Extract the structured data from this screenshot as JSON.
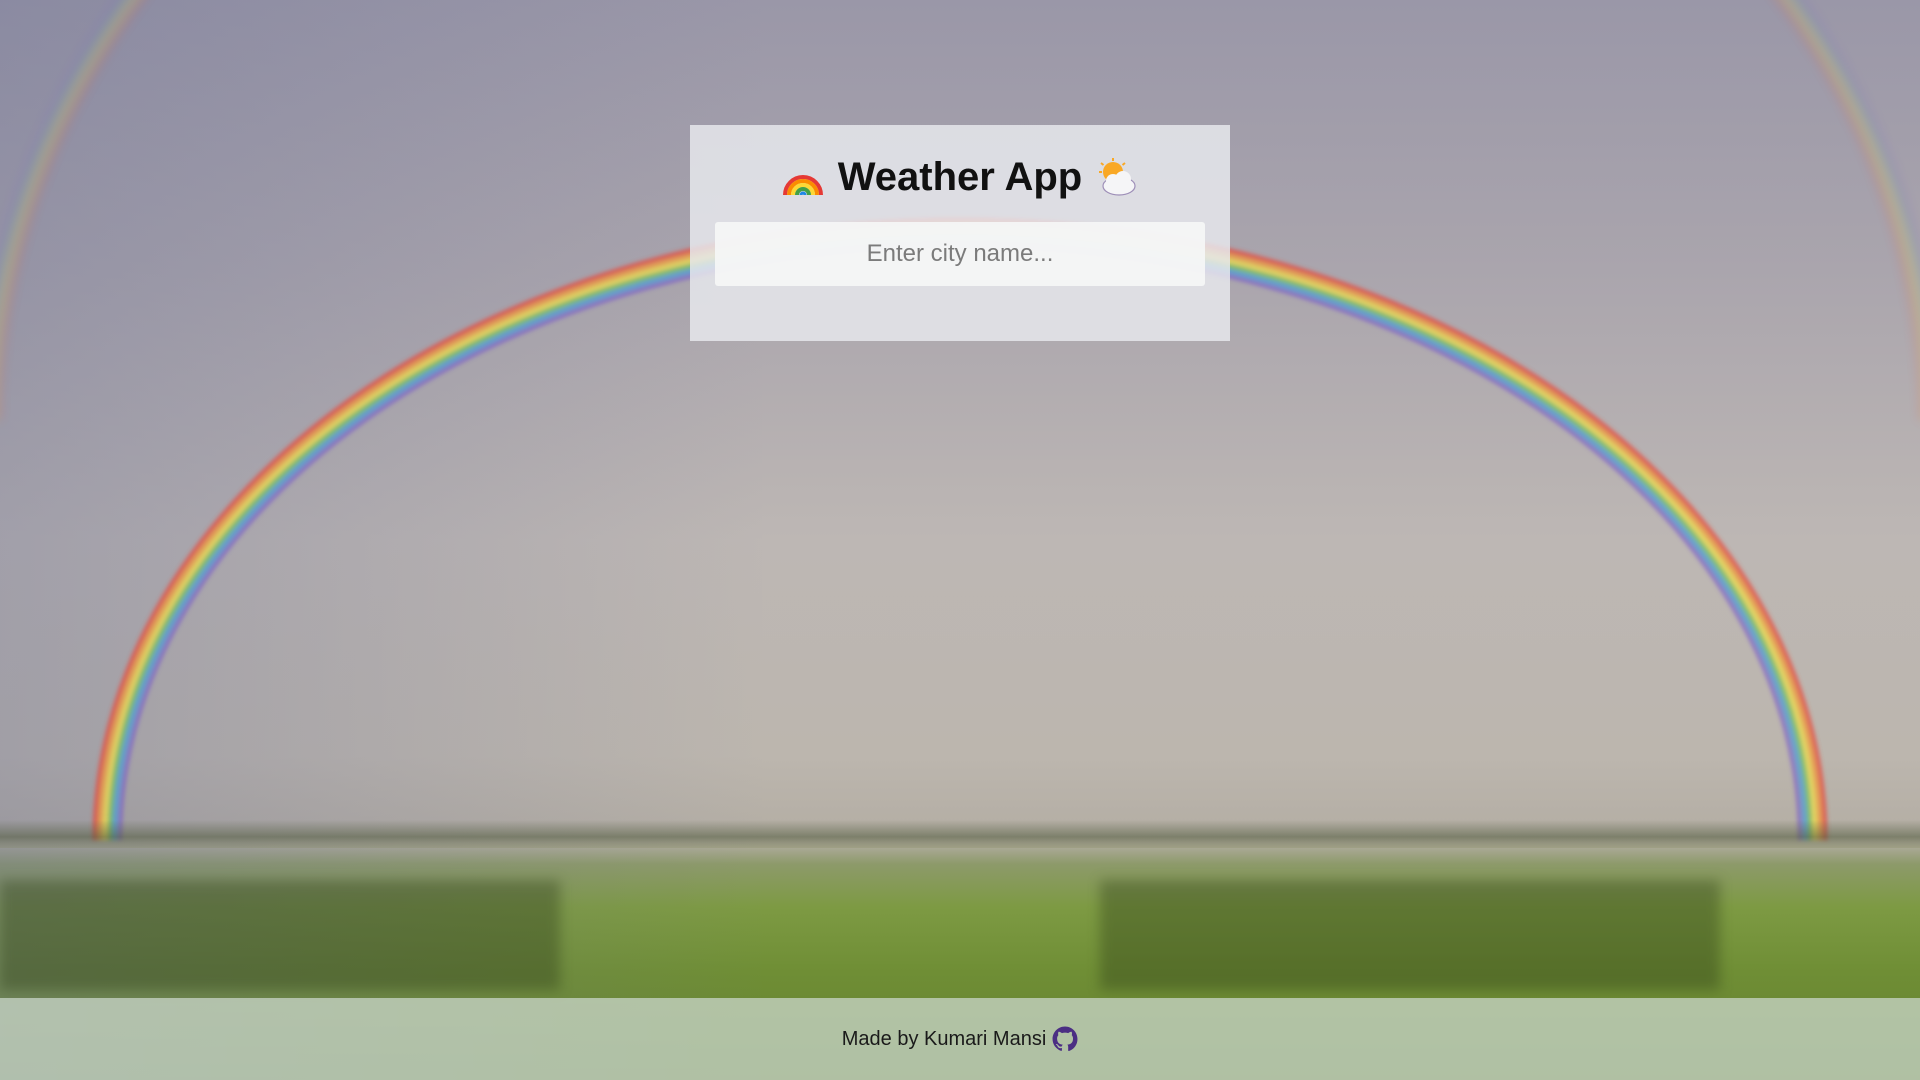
{
  "app": {
    "title": "Weather App",
    "title_left_icon": "rainbow-icon",
    "title_right_icon": "sun-behind-cloud-icon"
  },
  "search": {
    "placeholder": "Enter city name...",
    "value": ""
  },
  "footer": {
    "text": "Made by Kumari Mansi",
    "link_icon": "github-icon"
  },
  "colors": {
    "card_bg": "#e6e8ec",
    "footer_bg": "#cddad0",
    "github_icon": "#4b2e83"
  }
}
